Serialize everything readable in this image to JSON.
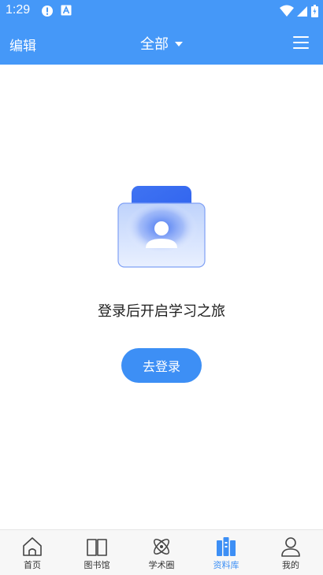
{
  "status_bar": {
    "time": "1:29",
    "icons": [
      "alert-icon",
      "a-letter-icon",
      "wifi-icon",
      "signal-icon",
      "battery-icon"
    ]
  },
  "header": {
    "edit_label": "编辑",
    "filter_label": "全部",
    "menu_icon": "hamburger-menu-icon",
    "background": "#4598f8"
  },
  "empty_state": {
    "illustration_icon": "user-card-icon",
    "message": "登录后开启学习之旅",
    "login_label": "去登录",
    "accent": "#3d8ff5"
  },
  "tab_bar": {
    "items": [
      {
        "label": "首页",
        "icon": "home-icon",
        "active": false
      },
      {
        "label": "图书馆",
        "icon": "book-icon",
        "active": false
      },
      {
        "label": "学术圈",
        "icon": "atom-icon",
        "active": false
      },
      {
        "label": "资料库",
        "icon": "library-icon",
        "active": true
      },
      {
        "label": "我的",
        "icon": "user-icon",
        "active": false
      }
    ]
  }
}
